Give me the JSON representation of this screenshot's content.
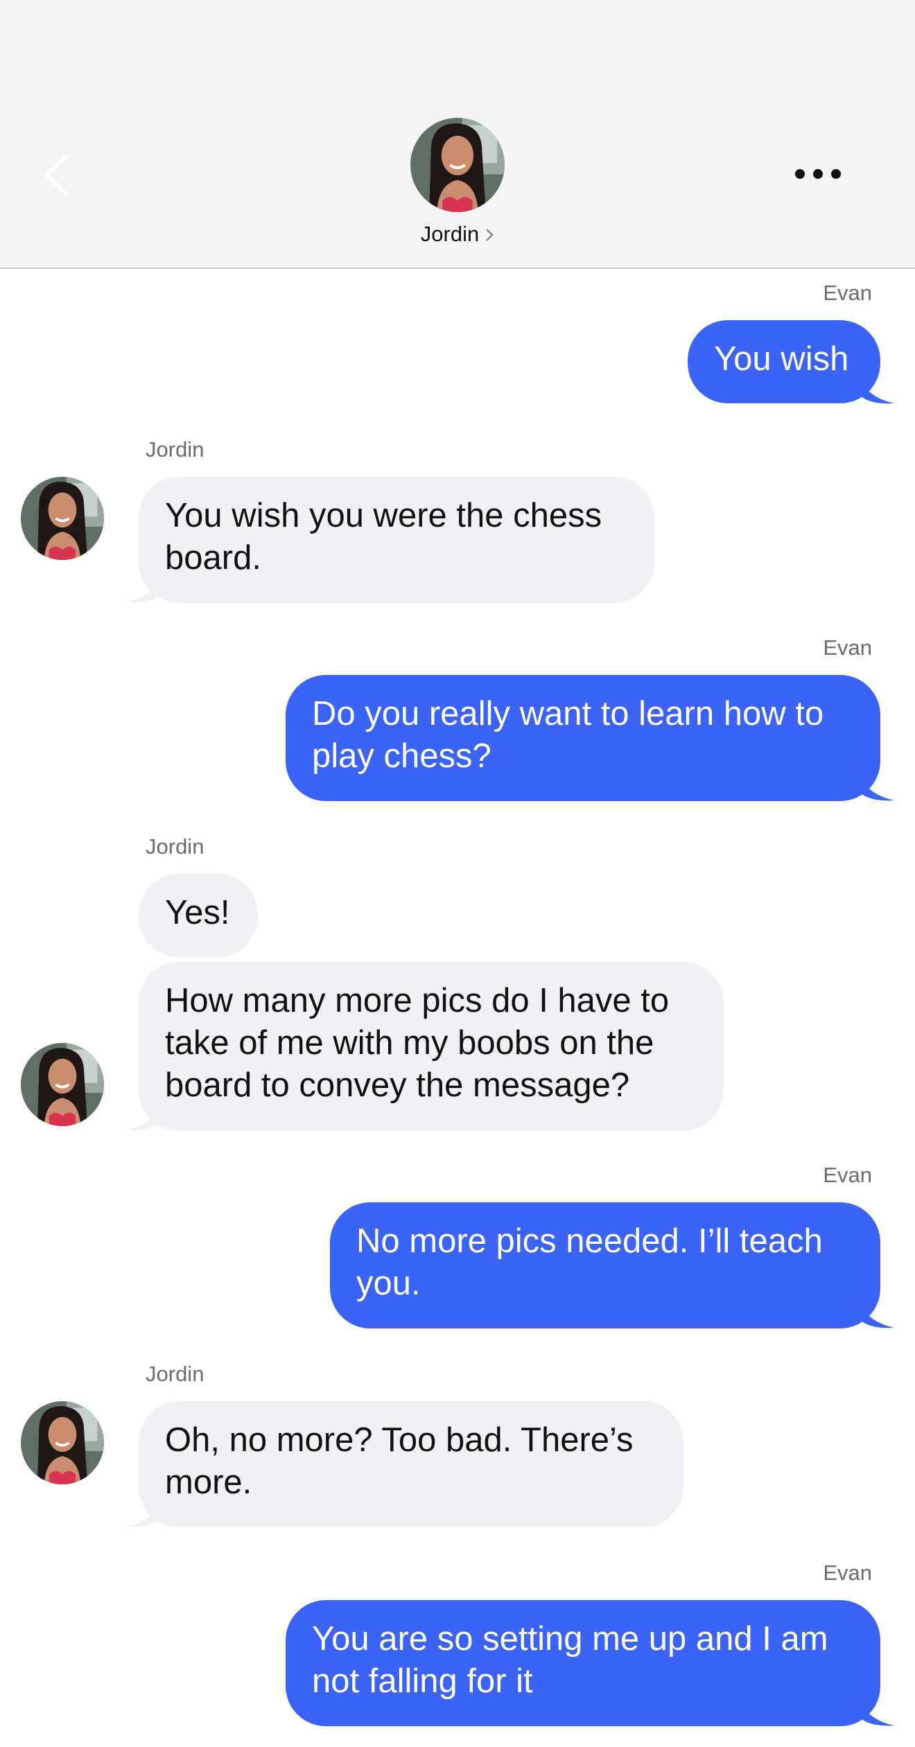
{
  "header": {
    "contact_name": "Jordin",
    "back_icon": "chevron-left-icon",
    "more_icon": "ellipsis-icon"
  },
  "colors": {
    "outgoing_bubble": "#3b63f5",
    "incoming_bubble": "#f0f0f5",
    "header_bg": "#f2f2f4"
  },
  "messages": [
    {
      "sender": "Evan",
      "direction": "outgoing",
      "text": "You wish"
    },
    {
      "sender": "Jordin",
      "direction": "incoming",
      "text": "You wish you were the chess board."
    },
    {
      "sender": "Evan",
      "direction": "outgoing",
      "text": "Do you really want to learn how to play chess?"
    },
    {
      "sender": "Jordin",
      "direction": "incoming",
      "text": "Yes!"
    },
    {
      "sender": "Jordin",
      "direction": "incoming",
      "text": "How many more pics do I have to take of me with my boobs on the board to convey the message?"
    },
    {
      "sender": "Evan",
      "direction": "outgoing",
      "text": "No more pics needed. I’ll teach you."
    },
    {
      "sender": "Jordin",
      "direction": "incoming",
      "text": "Oh, no more? Too bad. There’s more."
    },
    {
      "sender": "Evan",
      "direction": "outgoing",
      "text": "You are so setting me up and I am not falling for it"
    }
  ]
}
